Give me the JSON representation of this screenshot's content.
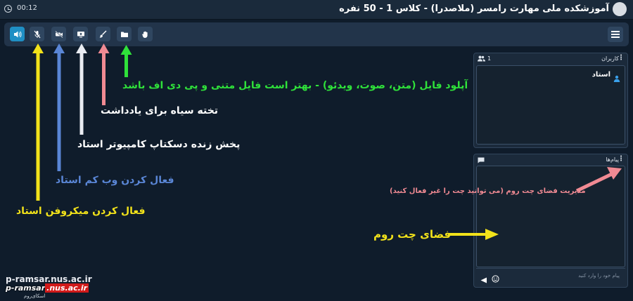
{
  "header": {
    "timer": "00:12",
    "room_title": "آموزشکده ملی مهارت رامسر (ملاصدرا) - کلاس 1 - 50 نفره"
  },
  "toolbar": {
    "buttons": [
      {
        "name": "speaker",
        "icon": "speaker-icon",
        "active": true
      },
      {
        "name": "microphone",
        "icon": "microphone-icon",
        "active": false
      },
      {
        "name": "webcam",
        "icon": "camera-off-icon",
        "active": false
      },
      {
        "name": "screen-share",
        "icon": "screen-share-icon",
        "active": false
      },
      {
        "name": "whiteboard",
        "icon": "brush-icon",
        "active": false
      },
      {
        "name": "file-upload",
        "icon": "folder-icon",
        "active": false
      },
      {
        "name": "raise-hand",
        "icon": "hand-icon",
        "active": false
      }
    ]
  },
  "users_panel": {
    "title": "کاربران",
    "count": "1",
    "users": [
      {
        "name": "استاد",
        "role_icon": "user-icon"
      }
    ]
  },
  "chat_panel": {
    "title": "پیام‌ها",
    "input_placeholder": "پیام خود را وارد کنید"
  },
  "annotations": {
    "upload": "آپلود فایل (متن، صوت، ویدئو) - بهتر است فایل متنی و پی دی اف باشد",
    "whiteboard": "تخته سیاه برای یادداشت",
    "screen_share": "پخش زنده دسکتاپ کامپیوتر استاد",
    "webcam": "فعال کردن وب کم استاد",
    "microphone": "فعال کردن میکروفن استاد",
    "chat_manage": "مدیریت فضای چت روم (می توانید چت را غیر فعال کنید)",
    "chat_space": "فضای چت روم"
  },
  "watermark": {
    "line1": "p-ramsar.nus.ac.ir",
    "line2_a": "p-ramsar",
    "line2_b": ".nus.ac.ir",
    "line3": "اسکای‌روم"
  },
  "colors": {
    "yellow": "#f2e21a",
    "blue": "#5a86d6",
    "white": "#e9ecf2",
    "pink": "#f08a93",
    "green": "#2fe13a",
    "red": "#d11a1a"
  }
}
